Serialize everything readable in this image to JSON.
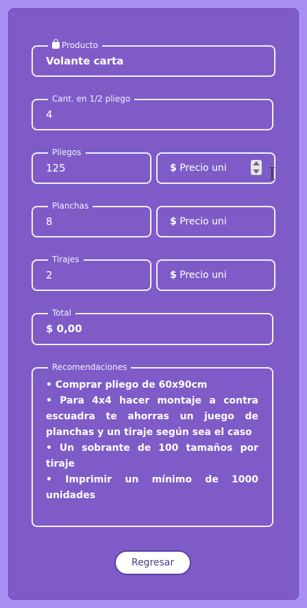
{
  "form": {
    "producto": {
      "label": "Producto",
      "value": "Volante carta"
    },
    "cant": {
      "label": "Cant. en 1/2 pliego",
      "value": "4"
    },
    "pliegos": {
      "label": "Pliegos",
      "value": "125",
      "price_placeholder": "Precio uni",
      "price_symbol": "$"
    },
    "planchas": {
      "label": "Planchas",
      "value": "8",
      "price_placeholder": "Precio uni",
      "price_symbol": "$"
    },
    "tirajes": {
      "label": "Tirajes",
      "value": "2",
      "price_placeholder": "Precio uni",
      "price_symbol": "$"
    },
    "total": {
      "label": "Total",
      "value": "$ 0,00"
    }
  },
  "recomendaciones": {
    "label": "Recomendaciones",
    "items": [
      "• Comprar pliego de 60x90cm",
      "• Para 4x4 hacer montaje a contra escuadra te ahorras un juego de planchas y un tiraje según sea el caso",
      "• Un sobrante de 100 tamaños por tiraje",
      "• Imprimir un mínimo de 1000 unidades"
    ]
  },
  "buttons": {
    "back": "Regresar"
  },
  "icons": {
    "producto": "shopping-bag-icon"
  },
  "colors": {
    "background": "#a98ef2",
    "card": "#7f5bc8",
    "border": "#f4f0ff"
  }
}
